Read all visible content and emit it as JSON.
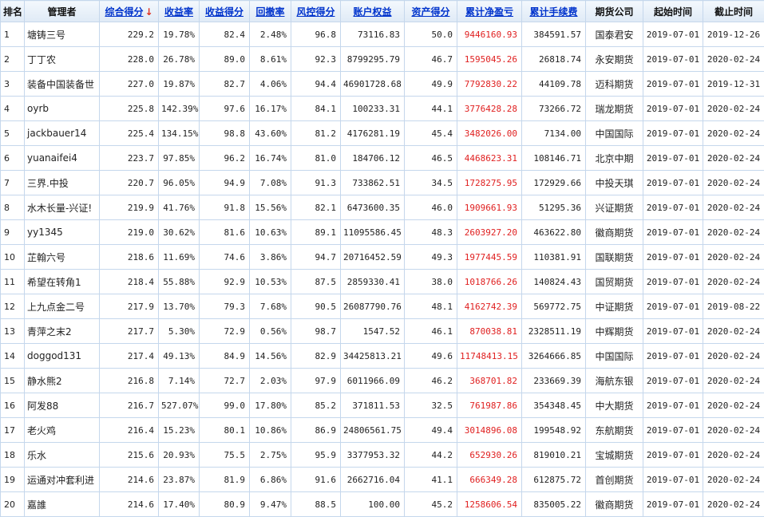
{
  "headers": {
    "rank": "排名",
    "manager": "管理者",
    "composite": "综合得分",
    "sort_arrow": "↓",
    "return_rate": "收益率",
    "return_score": "收益得分",
    "drawdown": "回撤率",
    "risk_score": "风控得分",
    "equity": "账户权益",
    "asset_score": "资产得分",
    "net_profit": "累计净盈亏",
    "fees": "累计手续费",
    "company": "期货公司",
    "start": "起始时间",
    "end": "截止时间"
  },
  "rows": [
    {
      "rank": "1",
      "manager": "塘铸三号",
      "composite": "229.2",
      "return_rate": "19.78%",
      "return_score": "82.4",
      "drawdown": "2.48%",
      "risk_score": "96.8",
      "equity": "73116.83",
      "asset_score": "50.0",
      "net_profit": "9446160.93",
      "fees": "384591.57",
      "company": "国泰君安",
      "start": "2019-07-01",
      "end": "2019-12-26"
    },
    {
      "rank": "2",
      "manager": "丁丁农",
      "composite": "228.0",
      "return_rate": "26.78%",
      "return_score": "89.0",
      "drawdown": "8.61%",
      "risk_score": "92.3",
      "equity": "8799295.79",
      "asset_score": "46.7",
      "net_profit": "1595045.26",
      "fees": "26818.74",
      "company": "永安期货",
      "start": "2019-07-01",
      "end": "2020-02-24"
    },
    {
      "rank": "3",
      "manager": "装备中国装备世",
      "composite": "227.0",
      "return_rate": "19.87%",
      "return_score": "82.7",
      "drawdown": "4.06%",
      "risk_score": "94.4",
      "equity": "46901728.68",
      "asset_score": "49.9",
      "net_profit": "7792830.22",
      "fees": "44109.78",
      "company": "迈科期货",
      "start": "2019-07-01",
      "end": "2019-12-31"
    },
    {
      "rank": "4",
      "manager": "oyrb",
      "composite": "225.8",
      "return_rate": "142.39%",
      "return_score": "97.6",
      "drawdown": "16.17%",
      "risk_score": "84.1",
      "equity": "100233.31",
      "asset_score": "44.1",
      "net_profit": "3776428.28",
      "fees": "73266.72",
      "company": "瑞龙期货",
      "start": "2019-07-01",
      "end": "2020-02-24"
    },
    {
      "rank": "5",
      "manager": "jackbauer14",
      "composite": "225.4",
      "return_rate": "134.15%",
      "return_score": "98.8",
      "drawdown": "43.60%",
      "risk_score": "81.2",
      "equity": "4176281.19",
      "asset_score": "45.4",
      "net_profit": "3482026.00",
      "fees": "7134.00",
      "company": "中国国际",
      "start": "2019-07-01",
      "end": "2020-02-24"
    },
    {
      "rank": "6",
      "manager": "yuanaifei4",
      "composite": "223.7",
      "return_rate": "97.85%",
      "return_score": "96.2",
      "drawdown": "16.74%",
      "risk_score": "81.0",
      "equity": "184706.12",
      "asset_score": "46.5",
      "net_profit": "4468623.31",
      "fees": "108146.71",
      "company": "北京中期",
      "start": "2019-07-01",
      "end": "2020-02-24"
    },
    {
      "rank": "7",
      "manager": "三界.中投",
      "composite": "220.7",
      "return_rate": "96.05%",
      "return_score": "94.9",
      "drawdown": "7.08%",
      "risk_score": "91.3",
      "equity": "733862.51",
      "asset_score": "34.5",
      "net_profit": "1728275.95",
      "fees": "172929.66",
      "company": "中投天琪",
      "start": "2019-07-01",
      "end": "2020-02-24"
    },
    {
      "rank": "8",
      "manager": "水木长量-兴证!",
      "composite": "219.9",
      "return_rate": "41.76%",
      "return_score": "91.8",
      "drawdown": "15.56%",
      "risk_score": "82.1",
      "equity": "6473600.35",
      "asset_score": "46.0",
      "net_profit": "1909661.93",
      "fees": "51295.36",
      "company": "兴证期货",
      "start": "2019-07-01",
      "end": "2020-02-24"
    },
    {
      "rank": "9",
      "manager": "yy1345",
      "composite": "219.0",
      "return_rate": "30.62%",
      "return_score": "81.6",
      "drawdown": "10.63%",
      "risk_score": "89.1",
      "equity": "11095586.45",
      "asset_score": "48.3",
      "net_profit": "2603927.20",
      "fees": "463622.80",
      "company": "徽商期货",
      "start": "2019-07-01",
      "end": "2020-02-24"
    },
    {
      "rank": "10",
      "manager": "芷翰六号",
      "composite": "218.6",
      "return_rate": "11.69%",
      "return_score": "74.6",
      "drawdown": "3.86%",
      "risk_score": "94.7",
      "equity": "20716452.59",
      "asset_score": "49.3",
      "net_profit": "1977445.59",
      "fees": "110381.91",
      "company": "国联期货",
      "start": "2019-07-01",
      "end": "2020-02-24"
    },
    {
      "rank": "11",
      "manager": "希望在转角1",
      "composite": "218.4",
      "return_rate": "55.88%",
      "return_score": "92.9",
      "drawdown": "10.53%",
      "risk_score": "87.5",
      "equity": "2859330.41",
      "asset_score": "38.0",
      "net_profit": "1018766.26",
      "fees": "140824.43",
      "company": "国贸期货",
      "start": "2019-07-01",
      "end": "2020-02-24"
    },
    {
      "rank": "12",
      "manager": "上九点金二号",
      "composite": "217.9",
      "return_rate": "13.70%",
      "return_score": "79.3",
      "drawdown": "7.68%",
      "risk_score": "90.5",
      "equity": "26087790.76",
      "asset_score": "48.1",
      "net_profit": "4162742.39",
      "fees": "569772.75",
      "company": "中证期货",
      "start": "2019-07-01",
      "end": "2019-08-22"
    },
    {
      "rank": "13",
      "manager": "青萍之末2",
      "composite": "217.7",
      "return_rate": "5.30%",
      "return_score": "72.9",
      "drawdown": "0.56%",
      "risk_score": "98.7",
      "equity": "1547.52",
      "asset_score": "46.1",
      "net_profit": "870038.81",
      "fees": "2328511.19",
      "company": "中辉期货",
      "start": "2019-07-01",
      "end": "2020-02-24"
    },
    {
      "rank": "14",
      "manager": "doggod131",
      "composite": "217.4",
      "return_rate": "49.13%",
      "return_score": "84.9",
      "drawdown": "14.56%",
      "risk_score": "82.9",
      "equity": "34425813.21",
      "asset_score": "49.6",
      "net_profit": "11748413.15",
      "fees": "3264666.85",
      "company": "中国国际",
      "start": "2019-07-01",
      "end": "2020-02-24"
    },
    {
      "rank": "15",
      "manager": "静水熊2",
      "composite": "216.8",
      "return_rate": "7.14%",
      "return_score": "72.7",
      "drawdown": "2.03%",
      "risk_score": "97.9",
      "equity": "6011966.09",
      "asset_score": "46.2",
      "net_profit": "368701.82",
      "fees": "233669.39",
      "company": "海航东银",
      "start": "2019-07-01",
      "end": "2020-02-24"
    },
    {
      "rank": "16",
      "manager": "阿发88",
      "composite": "216.7",
      "return_rate": "527.07%",
      "return_score": "99.0",
      "drawdown": "17.80%",
      "risk_score": "85.2",
      "equity": "371811.53",
      "asset_score": "32.5",
      "net_profit": "761987.86",
      "fees": "354348.45",
      "company": "中大期货",
      "start": "2019-07-01",
      "end": "2020-02-24"
    },
    {
      "rank": "17",
      "manager": "老火鸡",
      "composite": "216.4",
      "return_rate": "15.23%",
      "return_score": "80.1",
      "drawdown": "10.86%",
      "risk_score": "86.9",
      "equity": "24806561.75",
      "asset_score": "49.4",
      "net_profit": "3014896.08",
      "fees": "199548.92",
      "company": "东航期货",
      "start": "2019-07-01",
      "end": "2020-02-24"
    },
    {
      "rank": "18",
      "manager": "乐水",
      "composite": "215.6",
      "return_rate": "20.93%",
      "return_score": "75.5",
      "drawdown": "2.75%",
      "risk_score": "95.9",
      "equity": "3377953.32",
      "asset_score": "44.2",
      "net_profit": "652930.26",
      "fees": "819010.21",
      "company": "宝城期货",
      "start": "2019-07-01",
      "end": "2020-02-24"
    },
    {
      "rank": "19",
      "manager": "运通对冲套利进",
      "composite": "214.6",
      "return_rate": "23.87%",
      "return_score": "81.9",
      "drawdown": "6.86%",
      "risk_score": "91.6",
      "equity": "2662716.04",
      "asset_score": "41.1",
      "net_profit": "666349.28",
      "fees": "612875.72",
      "company": "首创期货",
      "start": "2019-07-01",
      "end": "2020-02-24"
    },
    {
      "rank": "20",
      "manager": "嘉誰",
      "composite": "214.6",
      "return_rate": "17.40%",
      "return_score": "80.9",
      "drawdown": "9.47%",
      "risk_score": "88.5",
      "equity": "100.00",
      "asset_score": "45.2",
      "net_profit": "1258606.54",
      "fees": "835005.22",
      "company": "徽商期货",
      "start": "2019-07-01",
      "end": "2020-02-24"
    }
  ],
  "colors": {
    "header_link": "#0033cc",
    "profit_red": "#e02020",
    "border": "#c5d7ec",
    "sort_arrow": "#e0301e"
  }
}
